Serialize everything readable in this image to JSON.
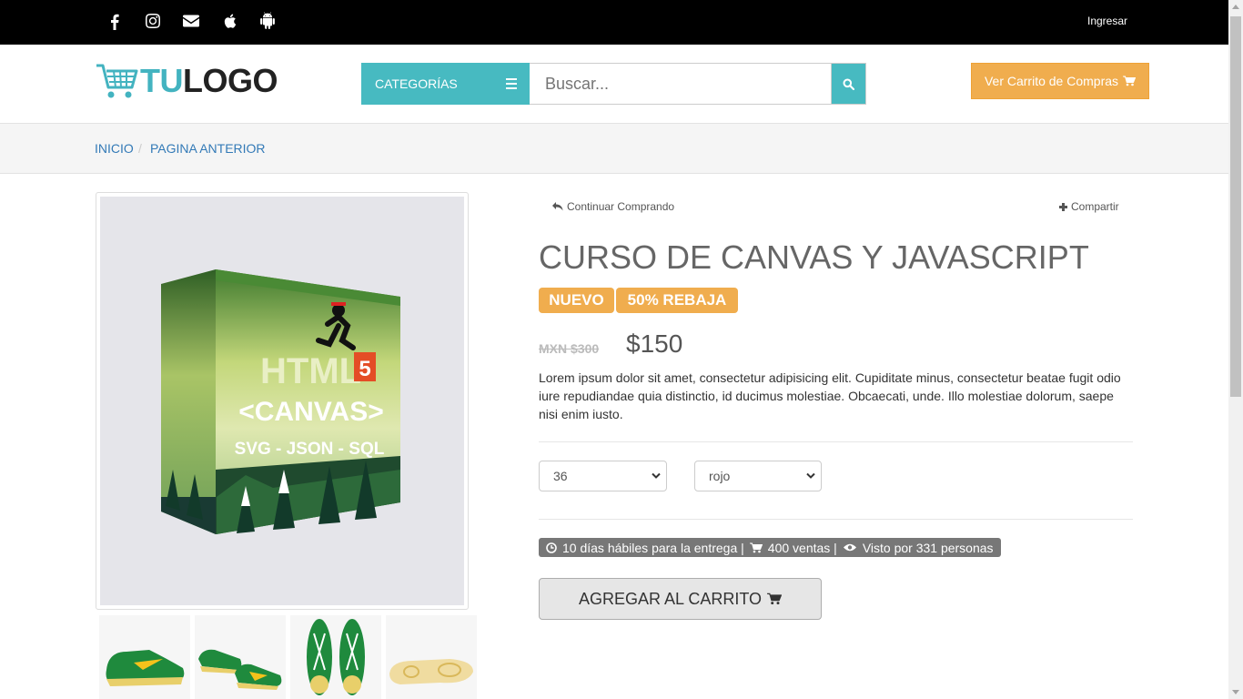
{
  "topbar": {
    "icons": [
      "facebook-icon",
      "instagram-icon",
      "envelope-icon",
      "apple-icon",
      "android-icon"
    ],
    "login_label": "Ingresar"
  },
  "header": {
    "logo_part1": "TU",
    "logo_part2": "LOGO",
    "categories_label": "CATEGORÍAS",
    "search_placeholder": "Buscar...",
    "cart_button_label": "Ver Carrito de Compras"
  },
  "breadcrumb": {
    "items": [
      "INICIO",
      "PAGINA ANTERIOR"
    ],
    "separator": "/"
  },
  "product": {
    "continue_label": "Continuar Comprando",
    "share_label": "Compartir",
    "title": "CURSO DE CANVAS Y JAVASCRIPT",
    "badge_new": "NUEVO",
    "badge_discount": "50% REBAJA",
    "old_price": "MXN $300",
    "price": "$150",
    "description": "Lorem ipsum dolor sit amet, consectetur adipisicing elit. Cupiditate minus, consectetur beatae fugit odio iure repudiandae quia distinctio, id ducimus molestiae. Obcaecati, unde. Illo molestiae dolorum, saepe nisi enim iusto.",
    "size_selected": "36",
    "color_selected": "rojo",
    "delivery_text": "10 días hábiles para la entrega |",
    "sales_text": "400 ventas |",
    "views_text": "Visto por 331 personas",
    "add_to_cart_label": "AGREGAR AL CARRITO",
    "box_art": {
      "line1": "HTML",
      "badge": "5",
      "line2": "<CANVAS>",
      "line3": "SVG - JSON - SQL"
    }
  },
  "colors": {
    "accent": "#47bac1",
    "orange": "#f0ad4e",
    "link": "#337ab7"
  }
}
